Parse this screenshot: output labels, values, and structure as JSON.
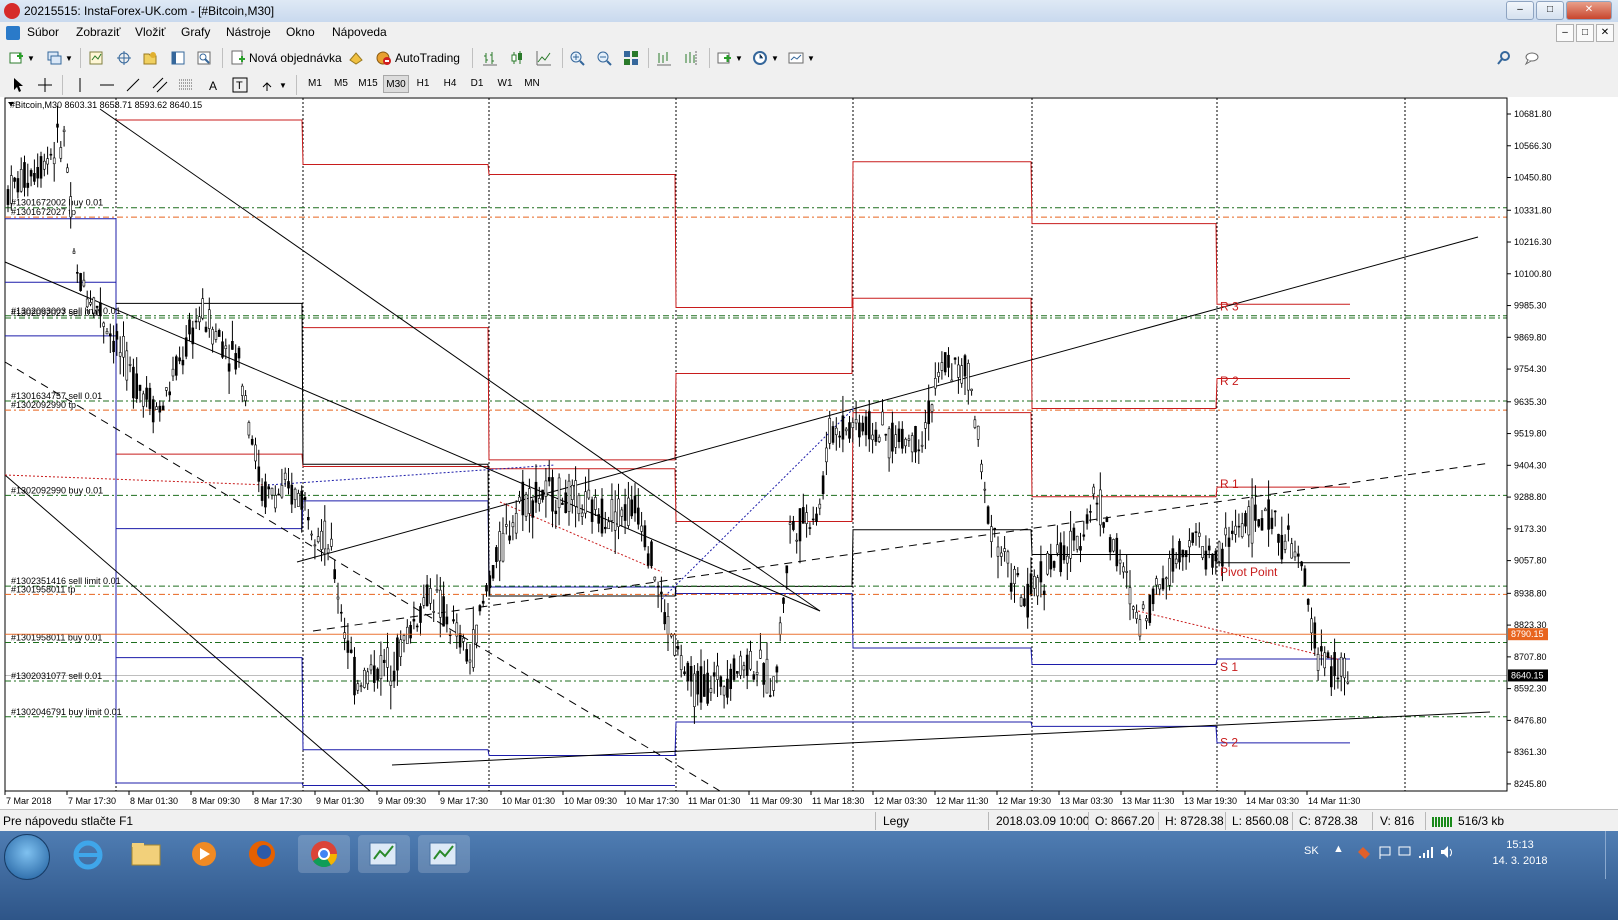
{
  "window": {
    "title": "20215515: InstaForex-UK.com - [#Bitcoin,M30]",
    "minimize_glyph": "–",
    "maximize_glyph": "□",
    "close_glyph": "✕"
  },
  "menu": {
    "items": [
      "Súbor",
      "Zobraziť",
      "Vložiť",
      "Grafy",
      "Nástroje",
      "Okno",
      "Nápoveda"
    ]
  },
  "toolbar": {
    "new_order_label": "Nová objednávka",
    "autotrading_label": "AutoTrading"
  },
  "timeframes": [
    "M1",
    "M5",
    "M15",
    "M30",
    "H1",
    "H4",
    "D1",
    "W1",
    "MN"
  ],
  "active_timeframe": "M30",
  "chart_header": {
    "symbol": "#Bitcoin,M30",
    "quote": "8603.31 8658.71 8593.62 8640.15"
  },
  "chart_data": {
    "type": "candlestick",
    "y_ticks": [
      10681.8,
      10566.3,
      10450.8,
      10331.8,
      10216.3,
      10100.8,
      9985.3,
      9869.8,
      9754.3,
      9635.3,
      9519.8,
      9404.3,
      9288.8,
      9173.3,
      9057.8,
      8938.8,
      8823.3,
      8707.8,
      8592.3,
      8476.8,
      8361.3,
      8245.8
    ],
    "y_tick_labels": [
      "10681.80",
      "10566.30",
      "10450.80",
      "10331.80",
      "10216.30",
      "10100.80",
      "9985.30",
      "9869.80",
      "9754.30",
      "9635.30",
      "9519.80",
      "9404.30",
      "9288.80",
      "9173.30",
      "9057.80",
      "8938.80",
      "8823.30",
      "8707.80",
      "8592.30",
      "8476.80",
      "8361.30",
      "8245.80"
    ],
    "x_tick_labels": [
      "7 Mar 2018",
      "7 Mar 17:30",
      "8 Mar 01:30",
      "8 Mar 09:30",
      "8 Mar 17:30",
      "9 Mar 01:30",
      "9 Mar 09:30",
      "9 Mar 17:30",
      "10 Mar 01:30",
      "10 Mar 09:30",
      "10 Mar 17:30",
      "11 Mar 01:30",
      "11 Mar 09:30",
      "11 Mar 18:30",
      "12 Mar 03:30",
      "12 Mar 11:30",
      "12 Mar 19:30",
      "13 Mar 03:30",
      "13 Mar 11:30",
      "13 Mar 19:30",
      "14 Mar 03:30",
      "14 Mar 11:30"
    ],
    "ylim": [
      8245.8,
      10740.0
    ],
    "price_marks": [
      {
        "label": "8790.15",
        "value": 8790.15,
        "color": "#e8641e"
      },
      {
        "label": "8640.15",
        "value": 8640.15,
        "color": "#000000"
      }
    ],
    "order_lines": [
      {
        "label": "#1301672002 buy 0.01",
        "value": 10341
      },
      {
        "label": "#1301672027 tp",
        "value": 10307
      },
      {
        "label": "#1302093003 sell limit 0.01",
        "value": 9948
      },
      {
        "label": "#1302092027 sell 0.01",
        "value": 9940
      },
      {
        "label": "#1301634757 sell 0.01",
        "value": 9638
      },
      {
        "label": "#1302092990 tp",
        "value": 9605
      },
      {
        "label": "#1302092990 buy 0.01",
        "value": 9295
      },
      {
        "label": "#1302351416 sell limit 0.01",
        "value": 8965
      },
      {
        "label": "#1301958011 tp",
        "value": 8935
      },
      {
        "label": "#1301958011 buy 0.01",
        "value": 8760
      },
      {
        "label": "#1302031077 sell 0.01",
        "value": 8620
      },
      {
        "label": "#1302046791 buy limit 0.01",
        "value": 8490
      }
    ],
    "pivot_labels": [
      {
        "label": "R 3",
        "value": 9985
      },
      {
        "label": "R 2",
        "value": 9715
      },
      {
        "label": "R 1",
        "value": 9340
      },
      {
        "label": "Pivot Point",
        "value": 9020
      },
      {
        "label": "S 1",
        "value": 8675
      },
      {
        "label": "S 2",
        "value": 8400
      }
    ],
    "grid": false,
    "colors": {
      "red_levels": "#c81c1c",
      "blue_levels": "#1c1caa",
      "green_dash": "#1e6e1e",
      "orange_dash": "#e8641e",
      "candles": "#000000"
    }
  },
  "statusbar": {
    "help": "Pre nápovedu stlačte F1",
    "profile": "Legy",
    "datetime": "2018.03.09 10:00",
    "open": "O: 8667.20",
    "high": "H: 8728.38",
    "low": "L: 8560.08",
    "close": "C: 8728.38",
    "volume": "V: 816",
    "traffic": "516/3 kb"
  },
  "taskbar": {
    "lang": "SK",
    "time": "15:13",
    "date": "14. 3. 2018"
  }
}
